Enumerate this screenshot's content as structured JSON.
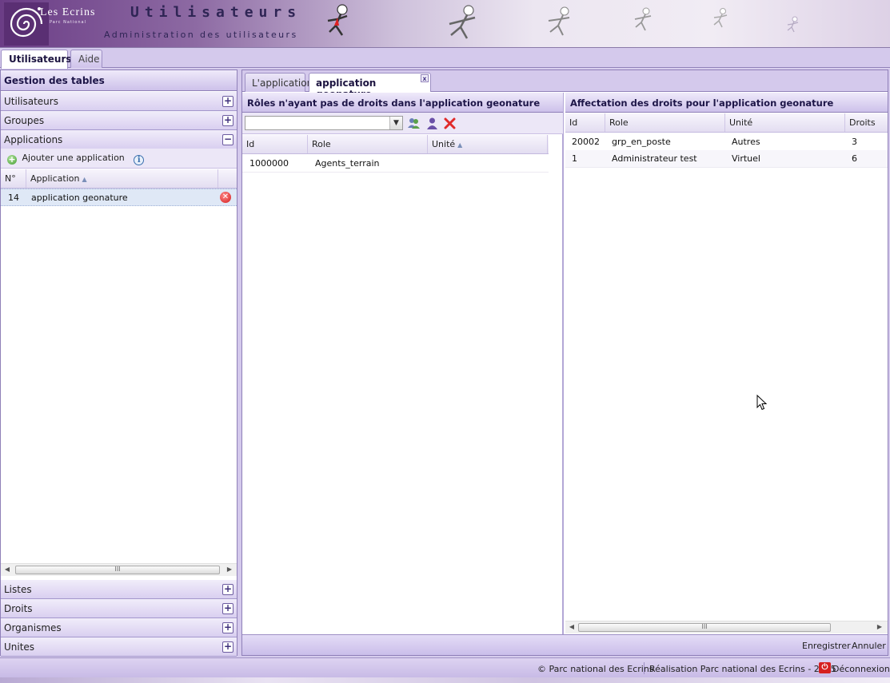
{
  "banner": {
    "brand_name": "Les Ecrins",
    "brand_subtitle": "Parc National",
    "title": "Utilisateurs",
    "subtitle": "Administration des utilisateurs"
  },
  "main_tabs": [
    {
      "label": "Utilisateurs",
      "active": true
    },
    {
      "label": "Aide",
      "active": false
    }
  ],
  "west": {
    "header": "Gestion des tables",
    "panels_top": [
      {
        "label": "Utilisateurs",
        "toggle": "+"
      },
      {
        "label": "Groupes",
        "toggle": "+"
      },
      {
        "label": "Applications",
        "toggle": "−"
      }
    ],
    "add_application_label": "Ajouter une application",
    "info_icon": "i",
    "columns": [
      "N°",
      "Application"
    ],
    "rows": [
      {
        "id": "14",
        "name": "application geonature"
      }
    ],
    "scroll_thumb": "III",
    "panels_bottom": [
      {
        "label": "Listes",
        "toggle": "+"
      },
      {
        "label": "Droits",
        "toggle": "+"
      },
      {
        "label": "Organismes",
        "toggle": "+"
      },
      {
        "label": "Unites",
        "toggle": "+"
      }
    ]
  },
  "center": {
    "tabs": [
      {
        "label": "L'application",
        "active": false
      },
      {
        "label": "application geonature",
        "active": true
      }
    ],
    "tab_close": "x",
    "left_pane": {
      "title": "Rôles n'ayant pas de droits dans l'application geonature",
      "combo_value": "",
      "columns": [
        "Id",
        "Role",
        "Unité"
      ],
      "rows": [
        {
          "id": "1000000",
          "role": "Agents_terrain",
          "unite": ""
        }
      ]
    },
    "right_pane": {
      "title": "Affectation des droits pour l'application geonature",
      "columns": [
        "Id",
        "Role",
        "Unité",
        "Droits"
      ],
      "rows": [
        {
          "id": "20002",
          "role": "grp_en_poste",
          "unite": "Autres",
          "droits": "3"
        },
        {
          "id": "1",
          "role": "Administrateur test",
          "unite": "Virtuel",
          "droits": "6"
        }
      ],
      "scroll_thumb": "III"
    },
    "footer": {
      "save_label": "Enregistrer",
      "cancel_label": "Annuler"
    }
  },
  "statusbar": {
    "copyright": "© Parc national des Ecrins",
    "credit": "Réalisation Parc national des Ecrins - 2015",
    "logout_label": "Déconnexion"
  },
  "colors": {
    "accent": "#8f80b8",
    "header_text": "#1d1548",
    "panel_bg": "#d4c9ec"
  }
}
